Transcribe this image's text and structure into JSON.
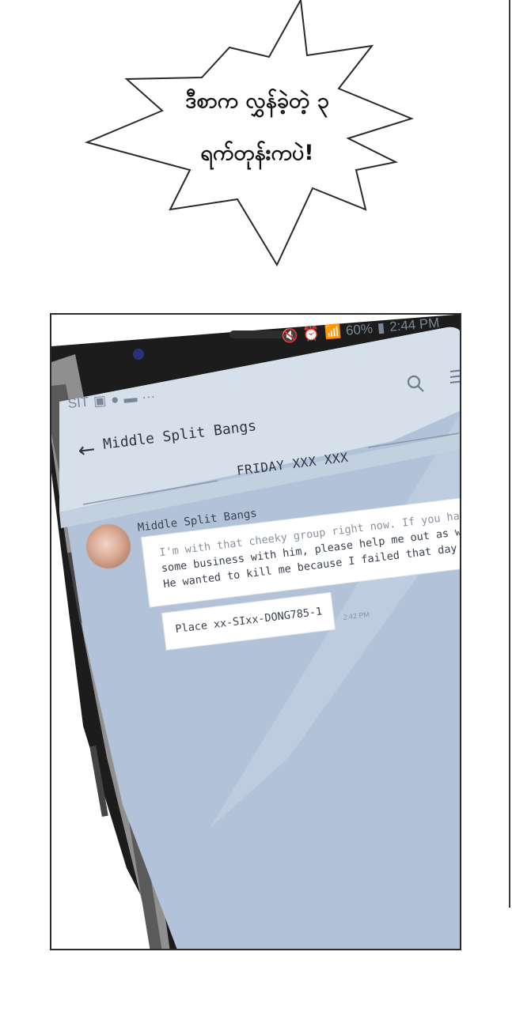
{
  "speech_bubble": {
    "line1": "ဒီစာက လွှန်ခဲ့တဲ့ ၃",
    "line2": "ရက်တုန်းကပဲ!"
  },
  "phone": {
    "status_bar": {
      "battery": "60%",
      "time": "2:44 PM"
    },
    "notification_text": "SIT",
    "header": {
      "back_icon": "left-arrow-icon",
      "title": "Middle Split Bangs",
      "search_icon": "search-icon",
      "menu_icon": "menu-icon"
    },
    "date_divider": "FRIDAY XXX XXX",
    "message": {
      "sender": "Middle Split Bangs",
      "lines": [
        "I'm with that cheeky group right now. If you have",
        "some business with him, please help me out as well.",
        "He wanted to kill me because I failed that day."
      ],
      "place": "Place xx-SIxx-DONG785-1",
      "time": "2:42 PM"
    }
  },
  "colors": {
    "screen_bg": "#b2c3d9",
    "screen_top": "#d8e1ec",
    "bezel": "#1a1a1a"
  }
}
